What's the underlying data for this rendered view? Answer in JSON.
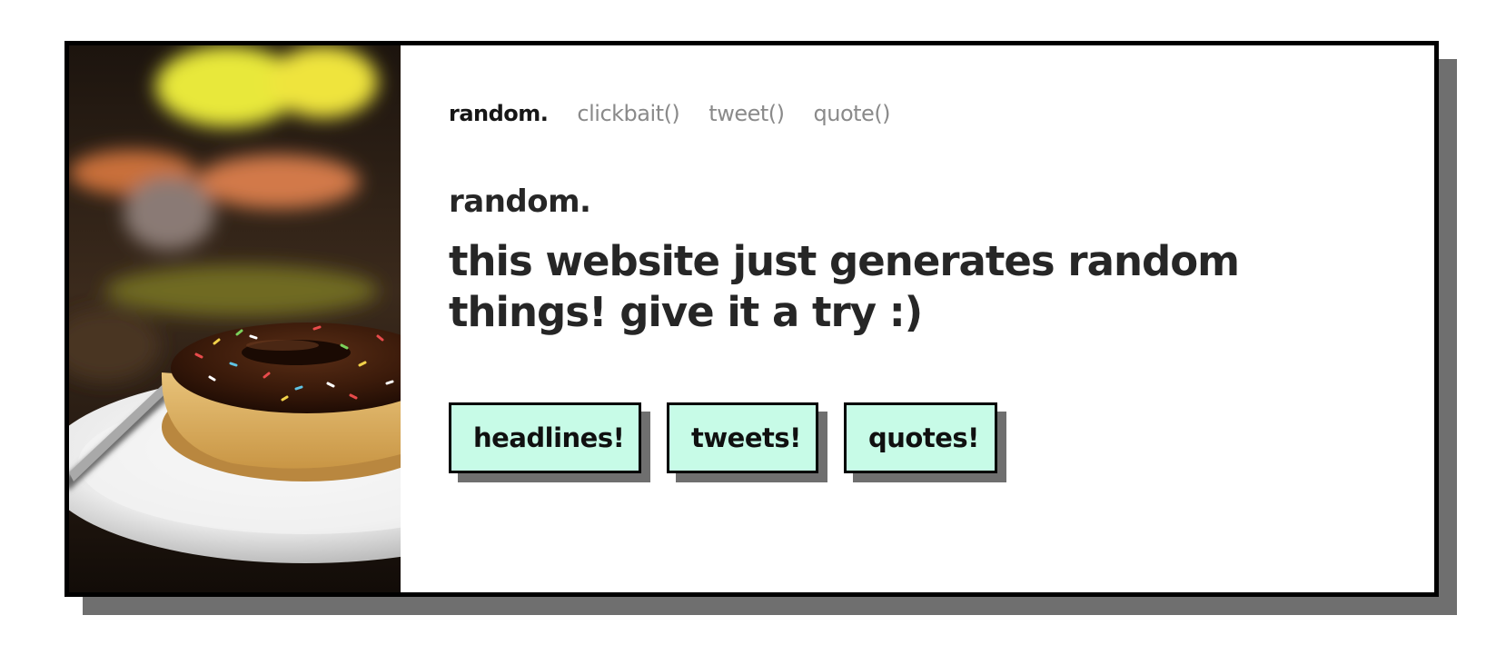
{
  "nav": {
    "brand": "random.",
    "links": [
      "clickbait()",
      "tweet()",
      "quote()"
    ]
  },
  "hero": {
    "heading": "random.",
    "tagline": "this website just generates random things! give it a try :)",
    "image_subject": "chocolate sprinkle donut on a white plate"
  },
  "buttons": {
    "headlines": "headlines!",
    "tweets": "tweets!",
    "quotes": "quotes!"
  },
  "colors": {
    "button_bg": "#c7fbe7",
    "shadow": "#6f6f6f",
    "border": "#000000",
    "text": "#262626",
    "nav_muted": "#8a8a8a"
  }
}
